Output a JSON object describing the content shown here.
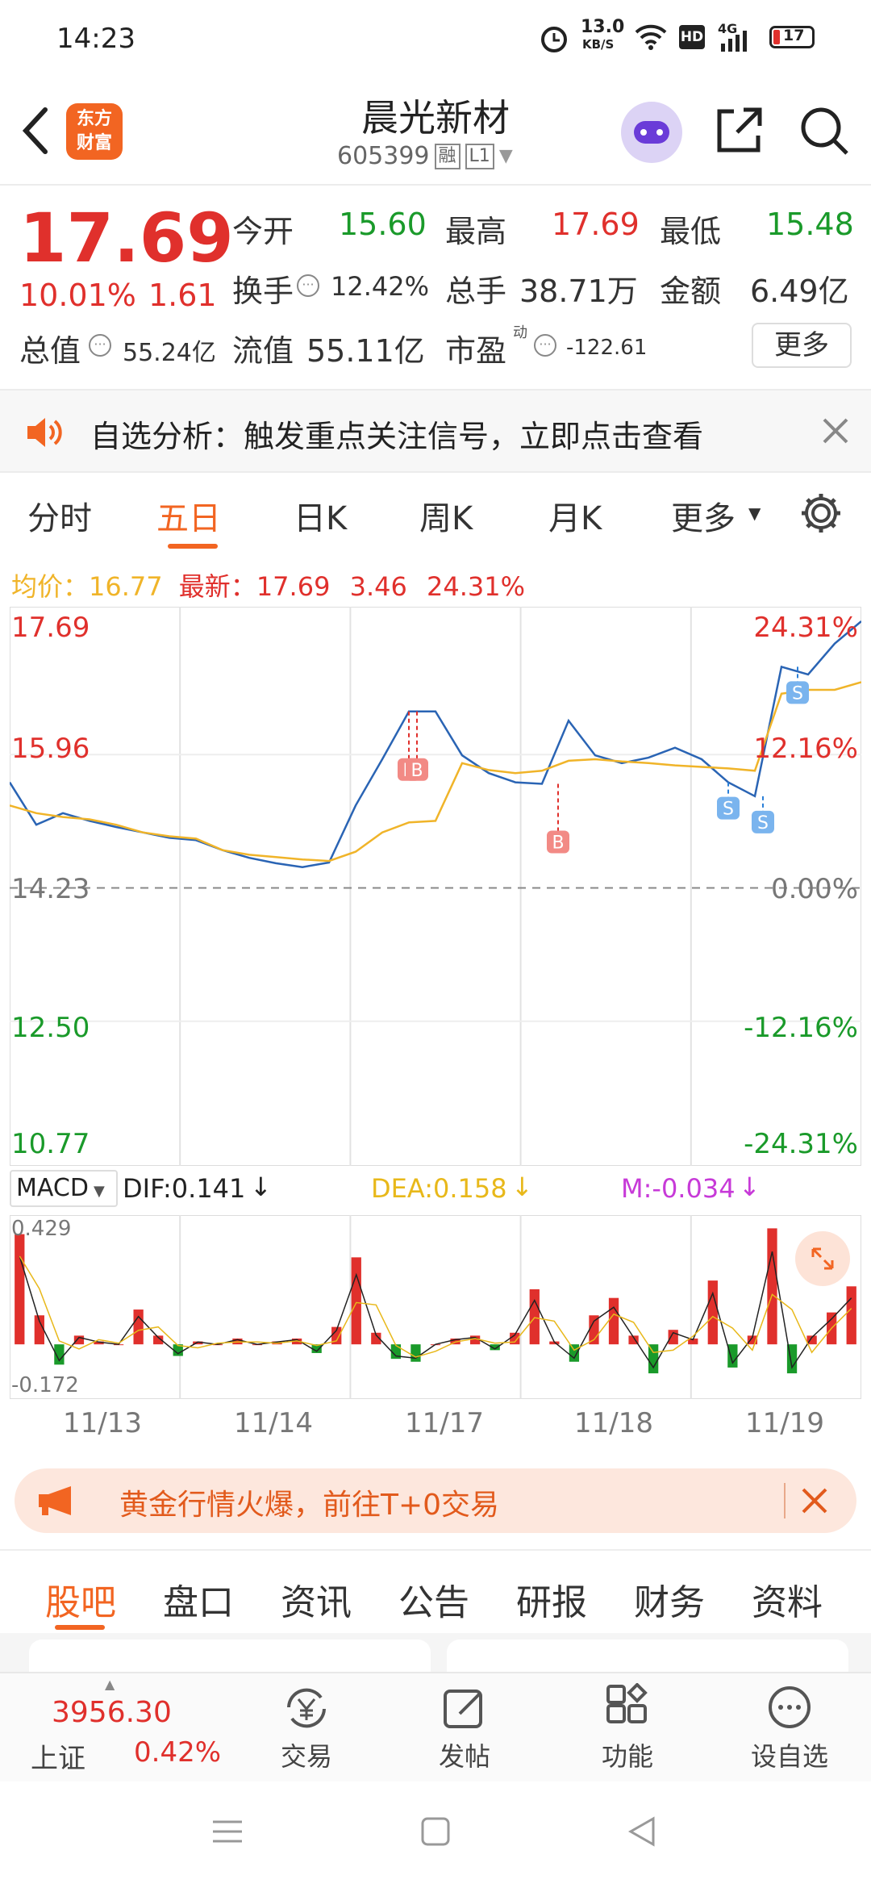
{
  "status": {
    "time": "14:23",
    "speed_value": "13.0",
    "speed_unit": "KB/S",
    "hd": "HD",
    "net": "4G",
    "battery": "17"
  },
  "header": {
    "stock_name": "晨光新材",
    "code": "605399",
    "rong": "融",
    "level": "L1",
    "brand_line1": "东方",
    "brand_line2": "财富"
  },
  "quote": {
    "price": "17.69",
    "change_pct": "10.01%",
    "change": "1.61",
    "open_label": "今开",
    "open": "15.60",
    "high_label": "最高",
    "high": "17.69",
    "low_label": "最低",
    "low": "15.48",
    "turnover_label": "换手",
    "turnover": "12.42%",
    "volume_label": "总手",
    "volume": "38.71万",
    "amount_label": "金额",
    "amount": "6.49亿",
    "mktcap_label": "总值",
    "mktcap": "55.24亿",
    "float_label": "流值",
    "float": "55.11亿",
    "pe_label": "市盈",
    "pe_sup": "动",
    "pe": "-122.61",
    "more": "更多"
  },
  "banner": {
    "text": "自选分析：触发重点关注信号，立即点击查看"
  },
  "tabs": [
    "分时",
    "五日",
    "日K",
    "周K",
    "月K",
    "更多"
  ],
  "info": {
    "avg_label": "均价：",
    "avg": "16.77",
    "latest_label": "最新：",
    "latest": "17.69",
    "change": "3.46",
    "pct": "24.31%"
  },
  "chart_data": {
    "type": "line",
    "title": "",
    "x": [
      "11/13",
      "11/14",
      "11/17",
      "11/18",
      "11/19"
    ],
    "y_ticks_left": [
      "17.69",
      "15.96",
      "14.23",
      "12.50",
      "10.77"
    ],
    "y_ticks_right": [
      "24.31%",
      "12.16%",
      "0.00%",
      "-12.16%",
      "-24.31%"
    ],
    "ylim": [
      10.77,
      17.69
    ],
    "prev_close": 14.23,
    "series": [
      {
        "values": [
          15.6,
          15.05,
          15.2,
          15.1,
          15.02,
          14.95,
          14.88,
          14.85,
          14.72,
          14.62,
          14.55,
          14.5,
          14.56,
          15.3,
          15.9,
          16.52,
          16.52,
          15.95,
          15.72,
          15.6,
          15.58,
          16.4,
          15.95,
          15.85,
          15.92,
          16.05,
          15.9,
          15.6,
          15.42,
          17.1,
          17.0,
          17.4,
          17.69
        ]
      },
      {
        "values": [
          15.3,
          15.2,
          15.15,
          15.12,
          15.05,
          14.95,
          14.9,
          14.87,
          14.72,
          14.66,
          14.63,
          14.6,
          14.58,
          14.7,
          14.95,
          15.08,
          15.1,
          15.85,
          15.76,
          15.72,
          15.75,
          15.88,
          15.9,
          15.87,
          15.85,
          15.82,
          15.8,
          15.78,
          15.75,
          16.75,
          16.8,
          16.8,
          16.9
        ]
      }
    ],
    "markers": [
      "B",
      "B",
      "B",
      "S",
      "S",
      "S"
    ]
  },
  "macd": {
    "type_label": "MACD",
    "dif": "DIF:0.141",
    "dea": "DEA:0.158",
    "m": "M:-0.034",
    "max": "0.429",
    "min": "-0.172",
    "chart_data": {
      "type": "bar",
      "title": "",
      "values": [
        0.38,
        0.1,
        -0.07,
        0.03,
        0.01,
        0.0,
        0.12,
        0.03,
        -0.04,
        0.01,
        0.0,
        0.02,
        0.0,
        0.01,
        0.02,
        -0.03,
        0.06,
        0.3,
        0.04,
        -0.05,
        -0.06,
        0.0,
        0.02,
        0.03,
        -0.02,
        0.04,
        0.19,
        0.01,
        -0.06,
        0.1,
        0.16,
        0.03,
        -0.1,
        0.05,
        0.02,
        0.22,
        -0.08,
        0.03,
        0.4,
        -0.1,
        0.03,
        0.11,
        0.2
      ]
    }
  },
  "dates": [
    "11/13",
    "11/14",
    "11/17",
    "11/18",
    "11/19"
  ],
  "promo": {
    "text": "黄金行情火爆，前往T+0交易"
  },
  "subtabs": [
    "股吧",
    "盘口",
    "资讯",
    "公告",
    "研报",
    "财务",
    "资料"
  ],
  "index": {
    "value": "3956.30",
    "name": "上证",
    "pct": "0.42%"
  },
  "bottom_nav": [
    {
      "label": "交易",
      "icon": "yen-cycle-icon"
    },
    {
      "label": "发帖",
      "icon": "edit-icon"
    },
    {
      "label": "功能",
      "icon": "grid-icon"
    },
    {
      "label": "设自选",
      "icon": "more-dots-icon"
    }
  ],
  "colors": {
    "up": "#e0302c",
    "down": "#1a9a2a",
    "accent": "#f26522",
    "line": "#2a64b4",
    "avg": "#f0b429"
  }
}
